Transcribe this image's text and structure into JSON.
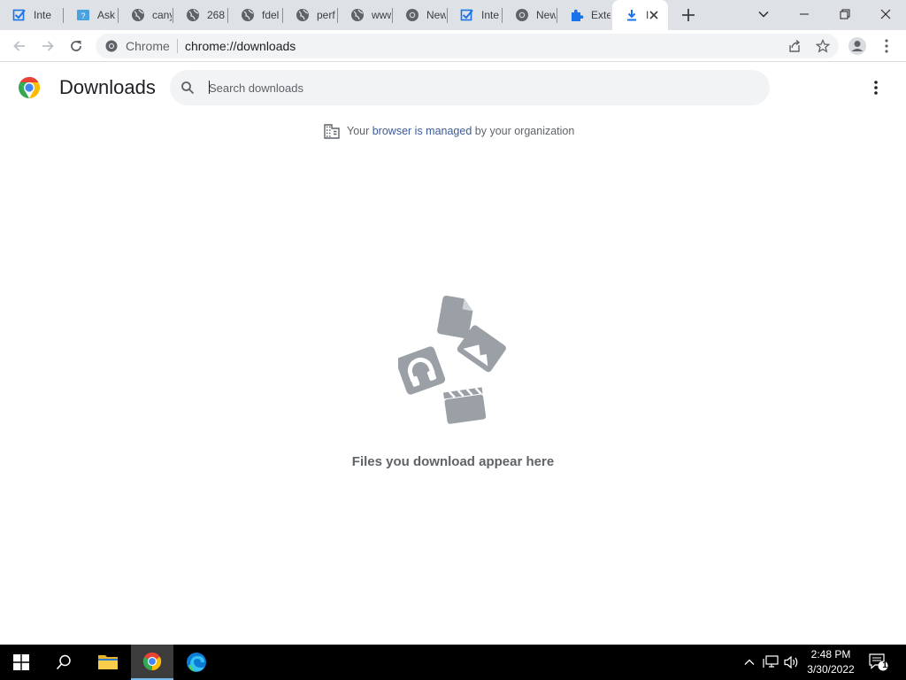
{
  "tabs": [
    {
      "title": "Inte",
      "icon": "checkbox-icon"
    },
    {
      "title": "Ask",
      "icon": "forum-icon"
    },
    {
      "title": "cany",
      "icon": "globe-icon"
    },
    {
      "title": "268",
      "icon": "globe-icon"
    },
    {
      "title": "fdel",
      "icon": "globe-icon"
    },
    {
      "title": "perf",
      "icon": "globe-icon"
    },
    {
      "title": "www",
      "icon": "globe-icon"
    },
    {
      "title": "New",
      "icon": "chrome-icon"
    },
    {
      "title": "Inte",
      "icon": "checkbox-icon"
    },
    {
      "title": "New",
      "icon": "chrome-icon"
    },
    {
      "title": "Exte",
      "icon": "puzzle-icon"
    },
    {
      "title": "I",
      "icon": "download-icon",
      "active": true
    }
  ],
  "toolbar": {
    "site_chip": "Chrome",
    "url": "chrome://downloads"
  },
  "downloads": {
    "title": "Downloads",
    "search_placeholder": "Search downloads",
    "managed_prefix": "Your ",
    "managed_link": "browser is managed",
    "managed_suffix": " by your organization",
    "empty_message": "Files you download appear here"
  },
  "taskbar": {
    "time": "2:48 PM",
    "date": "3/30/2022",
    "notification_count": "1"
  },
  "colors": {
    "tabstrip_bg": "#dee1e6",
    "link": "#3c5a9c",
    "omnibox_bg": "#f1f3f4",
    "empty_art": "#9aa0a6"
  }
}
